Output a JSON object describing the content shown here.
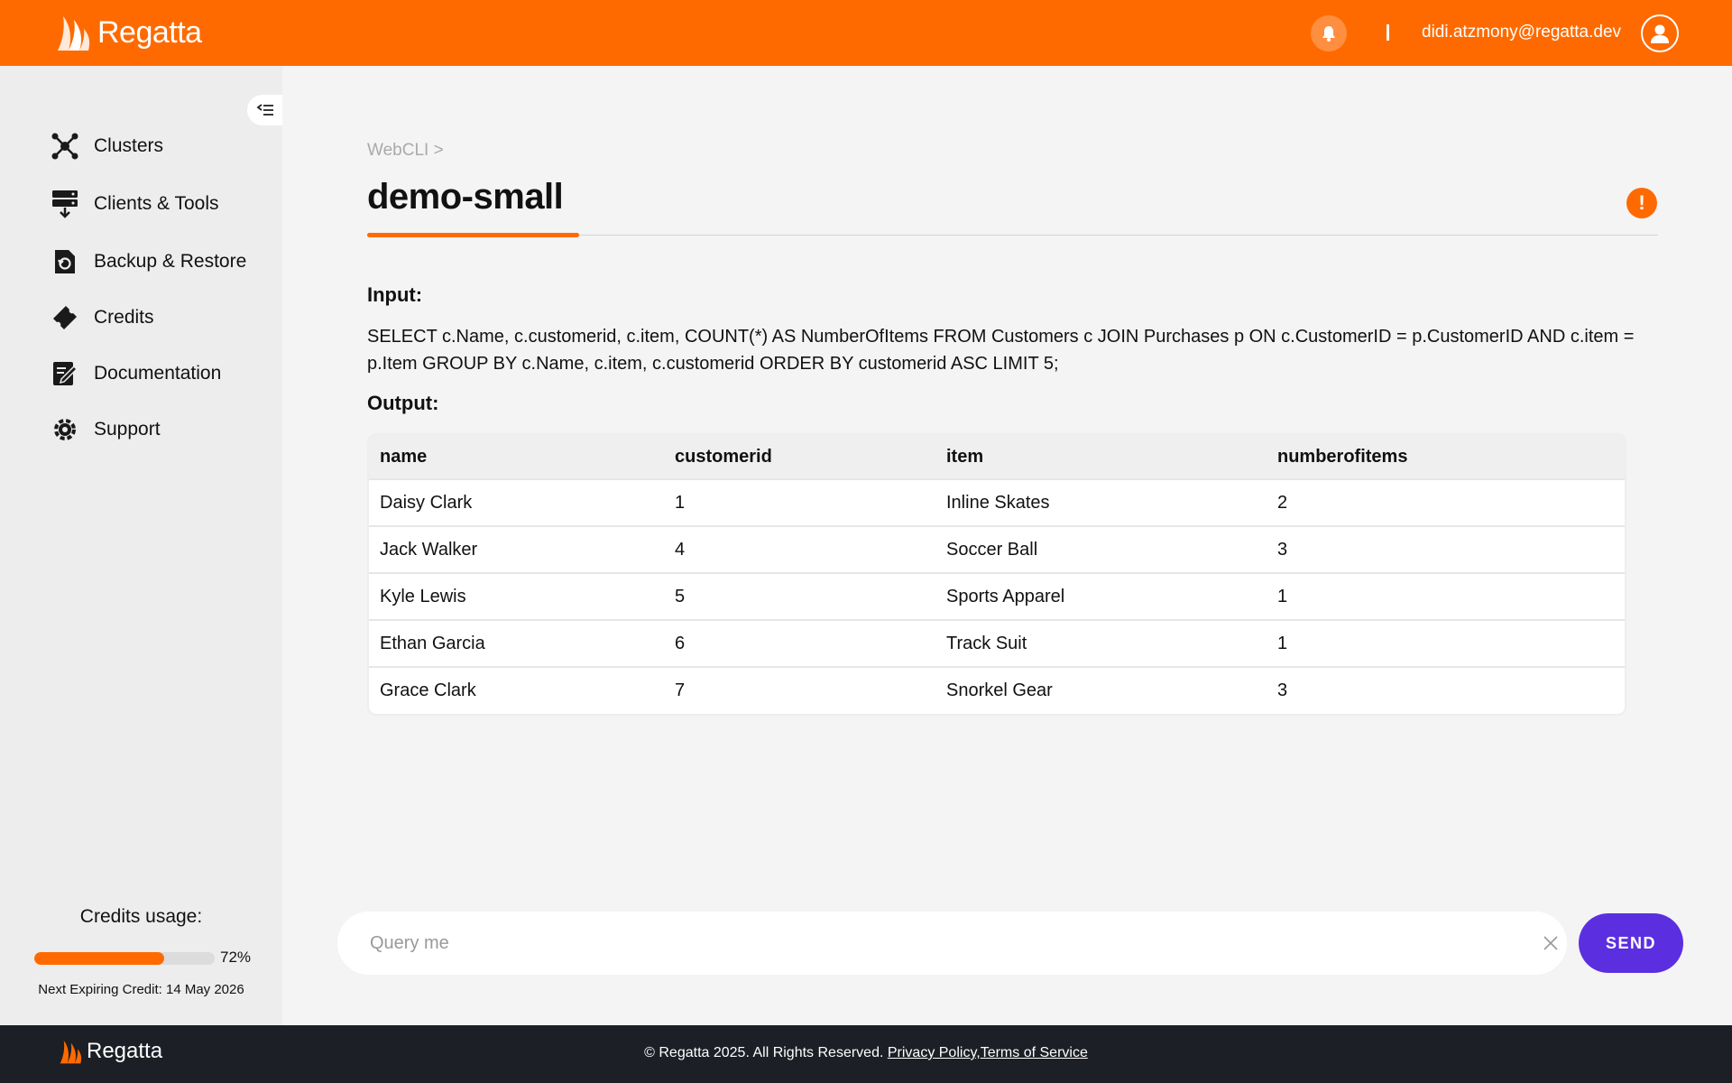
{
  "header": {
    "brand": "Regatta",
    "user_email": "didi.atzmony@regatta.dev",
    "icons": {
      "notifications": "bell-icon",
      "account": "user-avatar-icon"
    }
  },
  "sidebar": {
    "items": [
      {
        "label": "Clusters",
        "icon": "clusters-icon"
      },
      {
        "label": "Clients & Tools",
        "icon": "clients-tools-icon"
      },
      {
        "label": "Backup & Restore",
        "icon": "backup-restore-icon"
      },
      {
        "label": "Credits",
        "icon": "credits-icon"
      },
      {
        "label": "Documentation",
        "icon": "documentation-icon"
      },
      {
        "label": "Support",
        "icon": "support-icon"
      }
    ],
    "credits": {
      "title": "Credits usage:",
      "usage_percent": 72,
      "usage_label": "72%",
      "next_expiring": "Next Expiring Credit: 14 May 2026"
    }
  },
  "main": {
    "breadcrumb": "WebCLI >",
    "title": "demo-small",
    "input_label": "Input:",
    "query": "SELECT c.Name, c.customerid, c.item, COUNT(*) AS NumberOfItems FROM Customers c JOIN Purchases p ON c.CustomerID = p.CustomerID AND c.item = p.Item GROUP BY c.Name, c.item, c.customerid ORDER BY customerid ASC LIMIT 5;",
    "output_label": "Output:",
    "table": {
      "columns": [
        "name",
        "customerid",
        "item",
        "numberofitems"
      ],
      "rows": [
        [
          "Daisy Clark",
          "1",
          "Inline Skates",
          "2"
        ],
        [
          "Jack Walker",
          "4",
          "Soccer Ball",
          "3"
        ],
        [
          "Kyle Lewis",
          "5",
          "Sports Apparel",
          "1"
        ],
        [
          "Ethan Garcia",
          "6",
          "Track Suit",
          "1"
        ],
        [
          "Grace Clark",
          "7",
          "Snorkel Gear",
          "3"
        ]
      ]
    }
  },
  "query_bar": {
    "placeholder": "Query me",
    "value": "",
    "send_label": "SEND"
  },
  "footer": {
    "brand": "Regatta",
    "copyright": "© Regatta 2025. All Rights Reserved.",
    "privacy_label": "Privacy Policy,",
    "terms_label": "Terms of Service"
  },
  "colors": {
    "accent": "#ff6a00",
    "send_button": "#5b2fe0",
    "footer_bg": "#1c1f26"
  }
}
